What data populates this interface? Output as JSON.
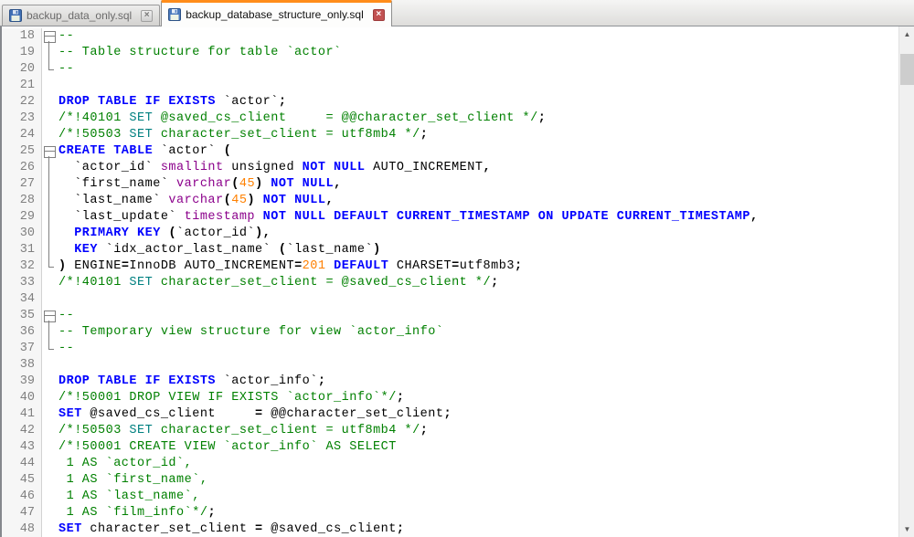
{
  "colors": {
    "keyword": "#0000ff",
    "type": "#8b008b",
    "number": "#ff8000",
    "comment": "#008000",
    "comment_keyword": "#008080",
    "plain": "#000000",
    "line_number": "#808080",
    "active_tab_accent": "#ff8c1a"
  },
  "tab_bar": {
    "close_glyph": "×",
    "tabs": [
      {
        "label": "backup_data_only.sql",
        "active": false
      },
      {
        "label": "backup_database_structure_only.sql",
        "active": true
      }
    ]
  },
  "scrollbar": {
    "up_glyph": "▲",
    "down_glyph": "▼"
  },
  "editor": {
    "first_line_number": 18,
    "last_line_number": 48,
    "lines": [
      {
        "n": 18,
        "fold": "start",
        "tokens": [
          [
            "comment",
            "--"
          ]
        ]
      },
      {
        "n": 19,
        "fold": "mid",
        "tokens": [
          [
            "comment",
            "-- Table structure for table `actor`"
          ]
        ]
      },
      {
        "n": 20,
        "fold": "end",
        "tokens": [
          [
            "comment",
            "--"
          ]
        ]
      },
      {
        "n": 21,
        "fold": "",
        "tokens": []
      },
      {
        "n": 22,
        "fold": "",
        "tokens": [
          [
            "kw",
            "DROP TABLE IF EXISTS"
          ],
          [
            "plain",
            " `actor`"
          ],
          [
            "op",
            ";"
          ]
        ]
      },
      {
        "n": 23,
        "fold": "",
        "tokens": [
          [
            "comment",
            "/*!40101 "
          ],
          [
            "commentkw",
            "SET"
          ],
          [
            "comment",
            " @saved_cs_client     = @@character_set_client */"
          ],
          [
            "op",
            ";"
          ]
        ]
      },
      {
        "n": 24,
        "fold": "",
        "tokens": [
          [
            "comment",
            "/*!50503 "
          ],
          [
            "commentkw",
            "SET"
          ],
          [
            "comment",
            " character_set_client = utf8mb4 */"
          ],
          [
            "op",
            ";"
          ]
        ]
      },
      {
        "n": 25,
        "fold": "start",
        "tokens": [
          [
            "kw",
            "CREATE TABLE"
          ],
          [
            "plain",
            " `actor` "
          ],
          [
            "op",
            "("
          ]
        ]
      },
      {
        "n": 26,
        "fold": "mid",
        "tokens": [
          [
            "plain",
            "  `actor_id` "
          ],
          [
            "type",
            "smallint"
          ],
          [
            "plain",
            " unsigned "
          ],
          [
            "kw",
            "NOT NULL"
          ],
          [
            "plain",
            " AUTO_INCREMENT"
          ],
          [
            "op",
            ","
          ]
        ]
      },
      {
        "n": 27,
        "fold": "mid",
        "tokens": [
          [
            "plain",
            "  `first_name` "
          ],
          [
            "type",
            "varchar"
          ],
          [
            "op",
            "("
          ],
          [
            "num",
            "45"
          ],
          [
            "op",
            ")"
          ],
          [
            "plain",
            " "
          ],
          [
            "kw",
            "NOT NULL"
          ],
          [
            "op",
            ","
          ]
        ]
      },
      {
        "n": 28,
        "fold": "mid",
        "tokens": [
          [
            "plain",
            "  `last_name` "
          ],
          [
            "type",
            "varchar"
          ],
          [
            "op",
            "("
          ],
          [
            "num",
            "45"
          ],
          [
            "op",
            ")"
          ],
          [
            "plain",
            " "
          ],
          [
            "kw",
            "NOT NULL"
          ],
          [
            "op",
            ","
          ]
        ]
      },
      {
        "n": 29,
        "fold": "mid",
        "tokens": [
          [
            "plain",
            "  `last_update` "
          ],
          [
            "type",
            "timestamp"
          ],
          [
            "plain",
            " "
          ],
          [
            "kw",
            "NOT NULL DEFAULT CURRENT_TIMESTAMP ON UPDATE CURRENT_TIMESTAMP"
          ],
          [
            "op",
            ","
          ]
        ]
      },
      {
        "n": 30,
        "fold": "mid",
        "tokens": [
          [
            "plain",
            "  "
          ],
          [
            "kw",
            "PRIMARY KEY"
          ],
          [
            "plain",
            " "
          ],
          [
            "op",
            "("
          ],
          [
            "plain",
            "`actor_id`"
          ],
          [
            "op",
            "),"
          ]
        ]
      },
      {
        "n": 31,
        "fold": "mid",
        "tokens": [
          [
            "plain",
            "  "
          ],
          [
            "kw",
            "KEY"
          ],
          [
            "plain",
            " `idx_actor_last_name` "
          ],
          [
            "op",
            "("
          ],
          [
            "plain",
            "`last_name`"
          ],
          [
            "op",
            ")"
          ]
        ]
      },
      {
        "n": 32,
        "fold": "end",
        "tokens": [
          [
            "op",
            ") "
          ],
          [
            "plain",
            "ENGINE"
          ],
          [
            "op",
            "="
          ],
          [
            "plain",
            "InnoDB AUTO_INCREMENT"
          ],
          [
            "op",
            "="
          ],
          [
            "num",
            "201"
          ],
          [
            "plain",
            " "
          ],
          [
            "kw",
            "DEFAULT"
          ],
          [
            "plain",
            " CHARSET"
          ],
          [
            "op",
            "="
          ],
          [
            "plain",
            "utf8mb3"
          ],
          [
            "op",
            ";"
          ]
        ]
      },
      {
        "n": 33,
        "fold": "",
        "tokens": [
          [
            "comment",
            "/*!40101 "
          ],
          [
            "commentkw",
            "SET"
          ],
          [
            "comment",
            " character_set_client = @saved_cs_client */"
          ],
          [
            "op",
            ";"
          ]
        ]
      },
      {
        "n": 34,
        "fold": "",
        "tokens": []
      },
      {
        "n": 35,
        "fold": "start",
        "tokens": [
          [
            "comment",
            "--"
          ]
        ]
      },
      {
        "n": 36,
        "fold": "mid",
        "tokens": [
          [
            "comment",
            "-- Temporary view structure for view `actor_info`"
          ]
        ]
      },
      {
        "n": 37,
        "fold": "end",
        "tokens": [
          [
            "comment",
            "--"
          ]
        ]
      },
      {
        "n": 38,
        "fold": "",
        "tokens": []
      },
      {
        "n": 39,
        "fold": "",
        "tokens": [
          [
            "kw",
            "DROP TABLE IF EXISTS"
          ],
          [
            "plain",
            " `actor_info`"
          ],
          [
            "op",
            ";"
          ]
        ]
      },
      {
        "n": 40,
        "fold": "",
        "tokens": [
          [
            "comment",
            "/*!50001 DROP VIEW IF EXISTS `actor_info`*/"
          ],
          [
            "op",
            ";"
          ]
        ]
      },
      {
        "n": 41,
        "fold": "",
        "tokens": [
          [
            "kw",
            "SET"
          ],
          [
            "plain",
            " @saved_cs_client     "
          ],
          [
            "op",
            "="
          ],
          [
            "plain",
            " @@character_set_client"
          ],
          [
            "op",
            ";"
          ]
        ]
      },
      {
        "n": 42,
        "fold": "",
        "tokens": [
          [
            "comment",
            "/*!50503 "
          ],
          [
            "commentkw",
            "SET"
          ],
          [
            "comment",
            " character_set_client = utf8mb4 */"
          ],
          [
            "op",
            ";"
          ]
        ]
      },
      {
        "n": 43,
        "fold": "",
        "tokens": [
          [
            "comment",
            "/*!50001 CREATE VIEW `actor_info` AS SELECT"
          ]
        ]
      },
      {
        "n": 44,
        "fold": "",
        "tokens": [
          [
            "comment",
            " 1 AS `actor_id`,"
          ]
        ]
      },
      {
        "n": 45,
        "fold": "",
        "tokens": [
          [
            "comment",
            " 1 AS `first_name`,"
          ]
        ]
      },
      {
        "n": 46,
        "fold": "",
        "tokens": [
          [
            "comment",
            " 1 AS `last_name`,"
          ]
        ]
      },
      {
        "n": 47,
        "fold": "",
        "tokens": [
          [
            "comment",
            " 1 AS `film_info`*/"
          ],
          [
            "op",
            ";"
          ]
        ]
      },
      {
        "n": 48,
        "fold": "",
        "tokens": [
          [
            "kw",
            "SET"
          ],
          [
            "plain",
            " character_set_client "
          ],
          [
            "op",
            "="
          ],
          [
            "plain",
            " @saved_cs_client"
          ],
          [
            "op",
            ";"
          ]
        ]
      }
    ]
  }
}
